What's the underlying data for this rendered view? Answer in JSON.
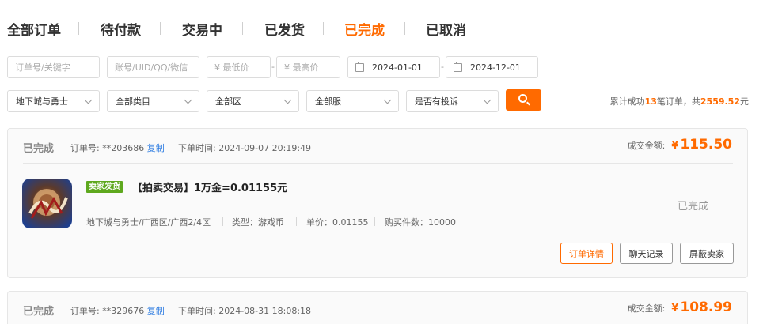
{
  "tabs": [
    {
      "label": "全部订单"
    },
    {
      "label": "待付款"
    },
    {
      "label": "交易中"
    },
    {
      "label": "已发货"
    },
    {
      "label": "已完成"
    },
    {
      "label": "已取消"
    }
  ],
  "active_tab": "已完成",
  "filters": {
    "keyword_placeholder": "订单号/关键字",
    "account_placeholder": "账号/UID/QQ/微信",
    "min_price_placeholder": "¥ 最低价",
    "max_price_placeholder": "¥ 最高价",
    "range_dash": "-",
    "start_date": "2024-01-01",
    "end_date": "2024-12-01"
  },
  "selects": {
    "game": "地下城与勇士",
    "category": "全部类目",
    "region": "全部区",
    "server": "全部服",
    "complaint": "是否有投诉"
  },
  "summary": {
    "prefix": "累计成功",
    "count": "13",
    "middle": "笔订单，共",
    "total": "2559.52",
    "suffix": "元"
  },
  "orders": [
    {
      "status": "已完成",
      "order_no_label": "订单号:",
      "order_no": "**203686",
      "copy_label": "复制",
      "time_label": "下单时间:",
      "time": "2024-09-07 20:19:49",
      "amount_label": "成交金额:",
      "currency": "¥",
      "amount": "115.50",
      "tag": "卖家发货",
      "title": "【拍卖交易】1万金=0.01155元",
      "details": {
        "server": "地下城与勇士/广西区/广西2/4区",
        "type": "类型：游戏币",
        "unit_price": "单价：0.01155",
        "quantity": "购买件数：10000"
      },
      "state_text": "已完成",
      "buttons": {
        "detail": "订单详情",
        "chat": "聊天记录",
        "block": "屏蔽卖家"
      }
    },
    {
      "status": "已完成",
      "order_no_label": "订单号:",
      "order_no": "**329676",
      "copy_label": "复制",
      "time_label": "下单时间:",
      "time": "2024-08-31 18:08:18",
      "amount_label": "成交金额:",
      "currency": "¥",
      "amount": "108.99"
    }
  ],
  "colors": {
    "accent": "#ff6a00",
    "link": "#2f7de1",
    "tag_green": "#5ea81e"
  }
}
